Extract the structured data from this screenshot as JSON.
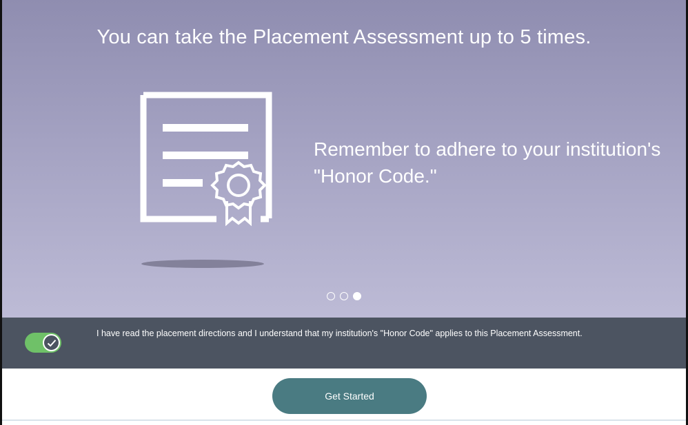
{
  "hero": {
    "headline": "You can take the Placement Assessment up to 5 times.",
    "message": "Remember to adhere to your institution's \"Honor Code.\"",
    "illustration_icon": "certificate-icon",
    "carousel": {
      "total": 3,
      "active_index": 2
    }
  },
  "acknowledgement": {
    "text": "I have read the placement directions and I understand that my institution's \"Honor Code\" applies to this Placement Assessment.",
    "checked": true,
    "toggle_icon": "check-icon"
  },
  "footer": {
    "get_started_label": "Get Started"
  },
  "colors": {
    "hero_top": "#8f8db0",
    "hero_bottom": "#bdbbd6",
    "ack_bar": "#4c5461",
    "toggle_on": "#6fc168",
    "button": "#4a7b82"
  }
}
